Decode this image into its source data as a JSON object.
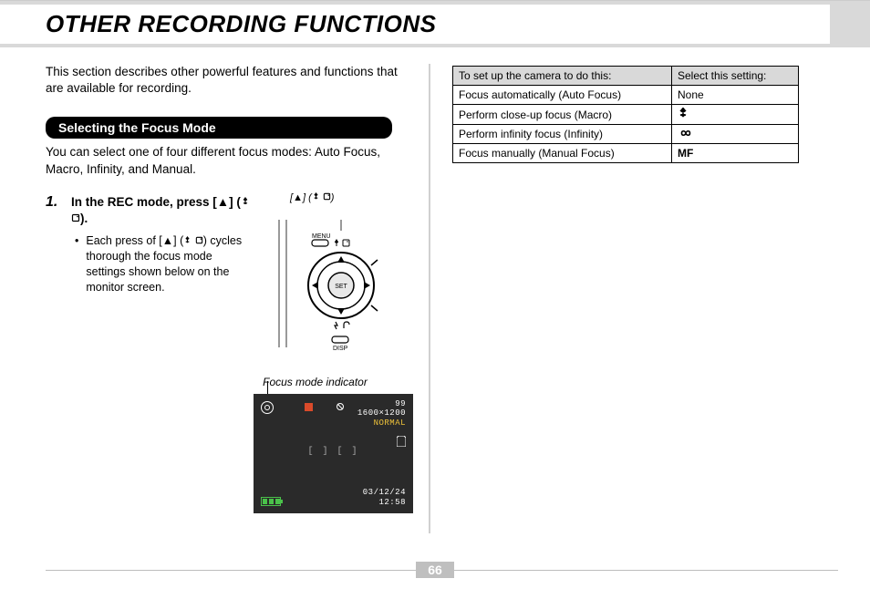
{
  "page": {
    "title": "OTHER RECORDING FUNCTIONS",
    "number": "66"
  },
  "intro": "This section describes other powerful features and functions that are available for recording.",
  "section": {
    "heading": "Selecting the Focus Mode",
    "body": "You can select one of four different focus modes: Auto Focus, Macro, Infinity, and Manual."
  },
  "step": {
    "number": "1.",
    "title_prefix": "In the REC mode, press [",
    "title_suffix": "] (",
    "title_end": ").",
    "bullet_prefix": "Each press of [",
    "bullet_mid": "] (",
    "bullet_suffix": ") cycles thorough the focus mode settings shown below on the monitor screen.",
    "button_callout_prefix": "[",
    "button_callout_mid": "] (",
    "button_callout_end": ")",
    "focus_label": "Focus mode indicator"
  },
  "icons": {
    "up": "▲",
    "tulip": "tulip-icon",
    "card": "card-icon",
    "infinity": "∞",
    "mf": "MF"
  },
  "diagram": {
    "menu_label": "MENU",
    "set_label": "SET",
    "disp_label": "DISP"
  },
  "lcd": {
    "remaining": "99",
    "resolution": "1600×1200",
    "quality": "NORMAL",
    "brackets": "[   ]  [   ]",
    "date": "03/12/24",
    "time": "12:58"
  },
  "table": {
    "head_action": "To set up the camera to do this:",
    "head_setting": "Select this setting:",
    "rows": [
      {
        "action": "Focus automatically (Auto Focus)",
        "setting_text": "None",
        "setting_icon": null
      },
      {
        "action": "Perform close-up focus (Macro)",
        "setting_text": "",
        "setting_icon": "tulip"
      },
      {
        "action": "Perform infinity focus (Infinity)",
        "setting_text": "",
        "setting_icon": "infinity"
      },
      {
        "action": "Focus manually (Manual Focus)",
        "setting_text": "MF",
        "setting_icon": null,
        "bold": true
      }
    ]
  }
}
